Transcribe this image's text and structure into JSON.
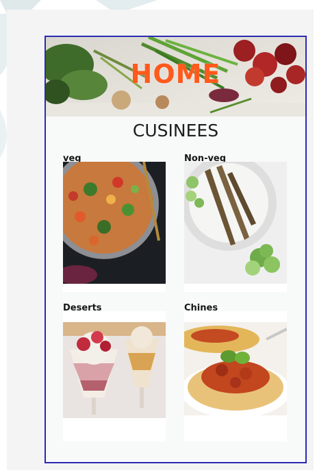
{
  "header": {
    "title": "HOME"
  },
  "section": {
    "title": "CUSINEES"
  },
  "cards": [
    {
      "label": "veg",
      "image": "fried-rice-vegetables"
    },
    {
      "label": "Non-veg",
      "image": "grilled-fish-cucumber"
    },
    {
      "label": "Deserts",
      "image": "ice-cream-sundae"
    },
    {
      "label": "Chines",
      "image": "spaghetti-bolognese"
    }
  ],
  "colors": {
    "title_accent": "#ff5a1c",
    "frame": "#2a2ab4"
  }
}
